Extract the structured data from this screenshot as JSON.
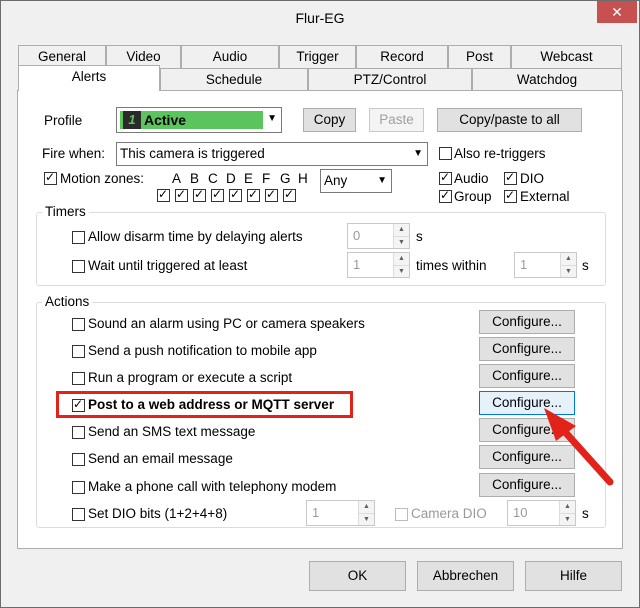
{
  "window": {
    "title": "Flur-EG",
    "close_glyph": "✕"
  },
  "tabs_row1": [
    "General",
    "Video",
    "Audio",
    "Trigger",
    "Record",
    "Post",
    "Webcast"
  ],
  "tabs_row2": [
    "Alerts",
    "Schedule",
    "PTZ/Control",
    "Watchdog"
  ],
  "active_tab": "Alerts",
  "profile": {
    "label": "Profile",
    "number": "1",
    "value": "Active",
    "swatch_color": "#5cc45c",
    "copy": "Copy",
    "paste": "Paste",
    "copy_all": "Copy/paste to all"
  },
  "fire_when": {
    "label": "Fire when:",
    "value": "This camera is triggered",
    "also_retriggers": "Also re-triggers"
  },
  "motion_zones": {
    "label": "Motion zones:",
    "zones": [
      "A",
      "B",
      "C",
      "D",
      "E",
      "F",
      "G",
      "H"
    ],
    "mode": "Any"
  },
  "sources": {
    "audio": "Audio",
    "dio": "DIO",
    "group": "Group",
    "external": "External"
  },
  "timers": {
    "title": "Timers",
    "disarm_label": "Allow disarm time by delaying alerts",
    "disarm_value": "0",
    "disarm_unit": "s",
    "wait_label": "Wait until triggered at least",
    "wait_value": "1",
    "times_within": "times within",
    "within_value": "1",
    "within_unit": "s"
  },
  "actions": {
    "title": "Actions",
    "configure_label": "Configure...",
    "items": [
      {
        "label": "Sound an alarm using PC or camera speakers",
        "checked": false
      },
      {
        "label": "Send a push notification to mobile app",
        "checked": false
      },
      {
        "label": "Run a program or execute a script",
        "checked": false
      },
      {
        "label": "Post to a web address or MQTT server",
        "checked": true
      },
      {
        "label": "Send an SMS text message",
        "checked": false
      },
      {
        "label": "Send an email message",
        "checked": false
      },
      {
        "label": "Make a phone call with telephony modem",
        "checked": false
      }
    ],
    "dio": {
      "label": "Set DIO bits (1+2+4+8)",
      "value": "1",
      "camera_dio": "Camera DIO",
      "dio_value": "10",
      "unit": "s"
    }
  },
  "buttons": {
    "ok": "OK",
    "cancel": "Abbrechen",
    "help": "Hilfe"
  },
  "annotation": {
    "color": "#e2231a"
  }
}
